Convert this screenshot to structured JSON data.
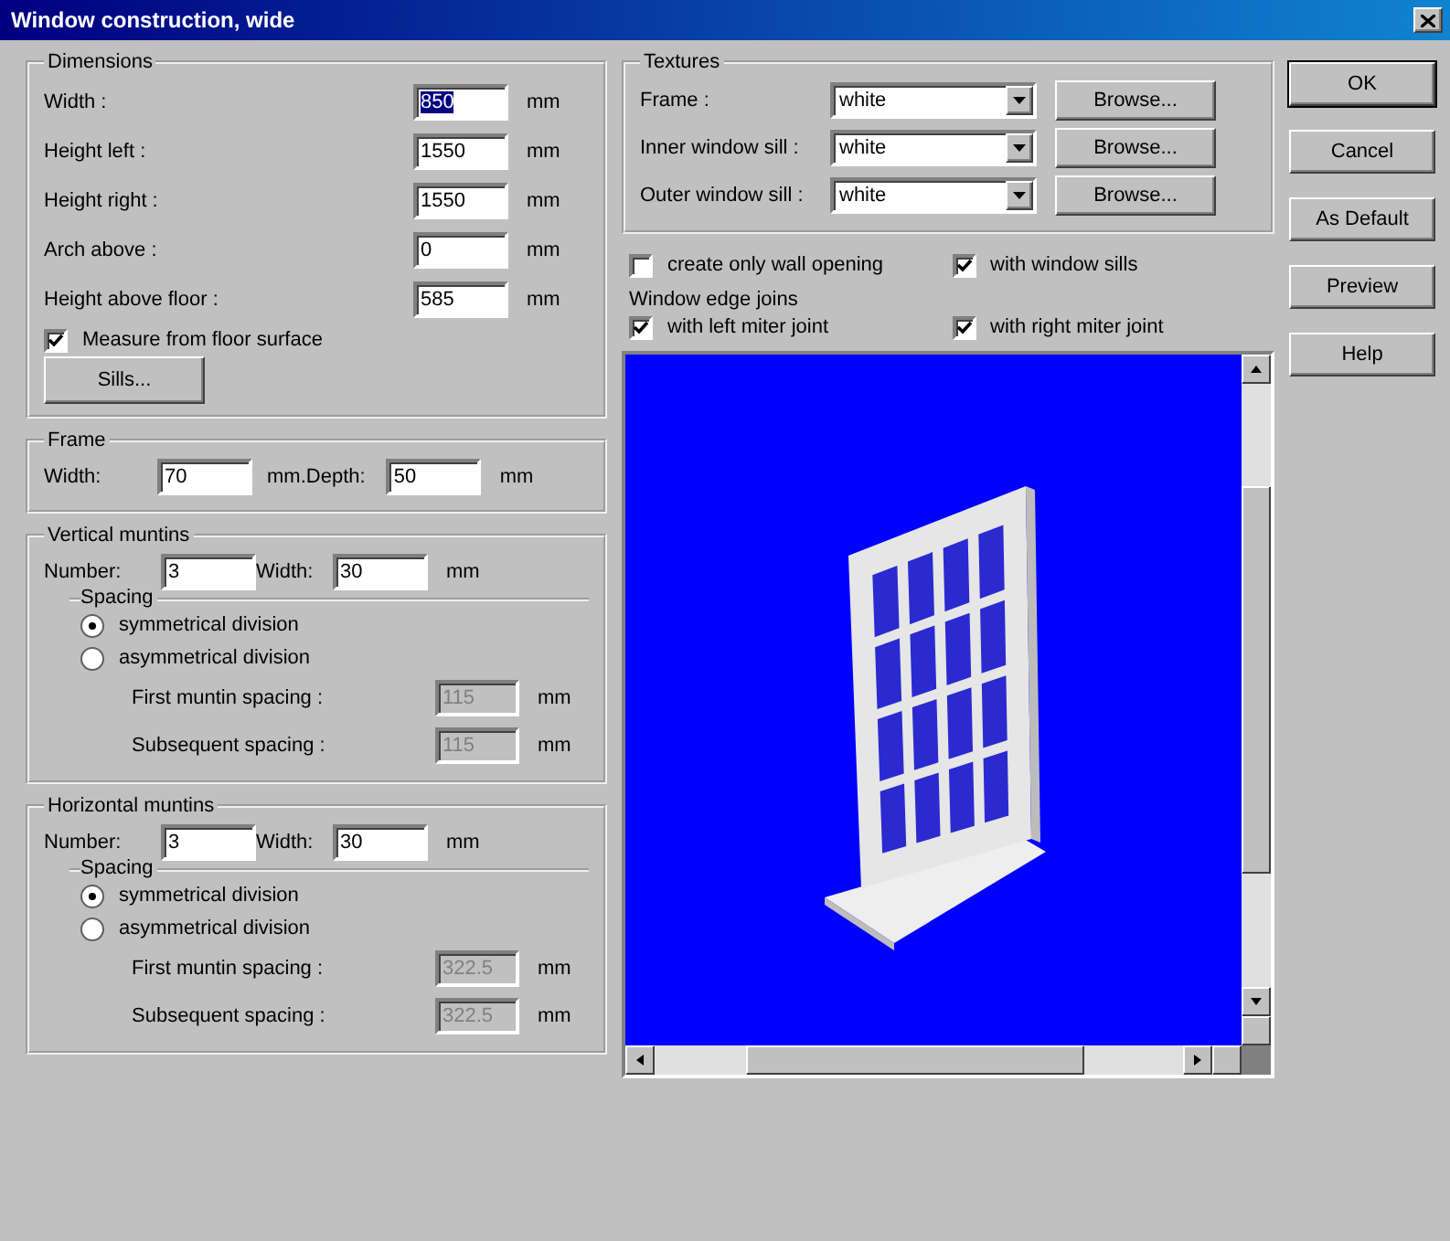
{
  "window": {
    "title": "Window construction, wide"
  },
  "dimensions": {
    "title": "Dimensions",
    "fields": [
      {
        "label": "Width :",
        "value": "850",
        "unit": "mm",
        "selected": true
      },
      {
        "label": "Height left :",
        "value": "1550",
        "unit": "mm",
        "selected": false
      },
      {
        "label": "Height right :",
        "value": "1550",
        "unit": "mm",
        "selected": false
      },
      {
        "label": "Arch above :",
        "value": "0",
        "unit": "mm",
        "selected": false
      },
      {
        "label": "Height above floor :",
        "value": "585",
        "unit": "mm",
        "selected": false
      }
    ],
    "measure": {
      "label": "Measure from floor surface",
      "checked": true
    },
    "sills_button": "Sills..."
  },
  "frame": {
    "title": "Frame",
    "width": {
      "label": "Width:",
      "value": "70",
      "unit": "mm."
    },
    "depth": {
      "label": "Depth:",
      "value": "50",
      "unit": "mm"
    }
  },
  "muntin_groups": [
    {
      "title": "Vertical muntins",
      "number": {
        "label": "Number:",
        "value": "3"
      },
      "width": {
        "label": "Width:",
        "value": "30",
        "unit": "mm"
      },
      "spacing": {
        "title": "Spacing",
        "options": [
          {
            "label": "symmetrical division",
            "selected": true
          },
          {
            "label": "asymmetrical division",
            "selected": false
          }
        ],
        "fields": [
          {
            "label": "First muntin spacing :",
            "value": "115",
            "unit": "mm",
            "disabled": true
          },
          {
            "label": "Subsequent spacing :",
            "value": "115",
            "unit": "mm",
            "disabled": true
          }
        ]
      }
    },
    {
      "title": "Horizontal muntins",
      "number": {
        "label": "Number:",
        "value": "3"
      },
      "width": {
        "label": "Width:",
        "value": "30",
        "unit": "mm"
      },
      "spacing": {
        "title": "Spacing",
        "options": [
          {
            "label": "symmetrical division",
            "selected": true
          },
          {
            "label": "asymmetrical division",
            "selected": false
          }
        ],
        "fields": [
          {
            "label": "First muntin spacing :",
            "value": "322.5",
            "unit": "mm",
            "disabled": true
          },
          {
            "label": "Subsequent spacing :",
            "value": "322.5",
            "unit": "mm",
            "disabled": true
          }
        ]
      }
    }
  ],
  "textures": {
    "title": "Textures",
    "rows": [
      {
        "label": "Frame :",
        "value": "white",
        "button": "Browse..."
      },
      {
        "label": "Inner window sill :",
        "value": "white",
        "button": "Browse..."
      },
      {
        "label": "Outer window sill :",
        "value": "white",
        "button": "Browse..."
      }
    ]
  },
  "options": [
    {
      "label": "create only wall opening",
      "checked": false
    },
    {
      "label": "with window sills",
      "checked": true
    }
  ],
  "edge_joins": {
    "title": "Window edge joins",
    "options": [
      {
        "label": "with left miter joint",
        "checked": true
      },
      {
        "label": "with right miter joint",
        "checked": true
      }
    ]
  },
  "buttons": [
    {
      "label": "OK",
      "kind": "default"
    },
    {
      "label": "Cancel",
      "kind": "normal"
    },
    {
      "label": "As Default",
      "kind": "normal"
    },
    {
      "label": "Preview",
      "kind": "normal"
    },
    {
      "label": "Help",
      "kind": "normal"
    }
  ]
}
